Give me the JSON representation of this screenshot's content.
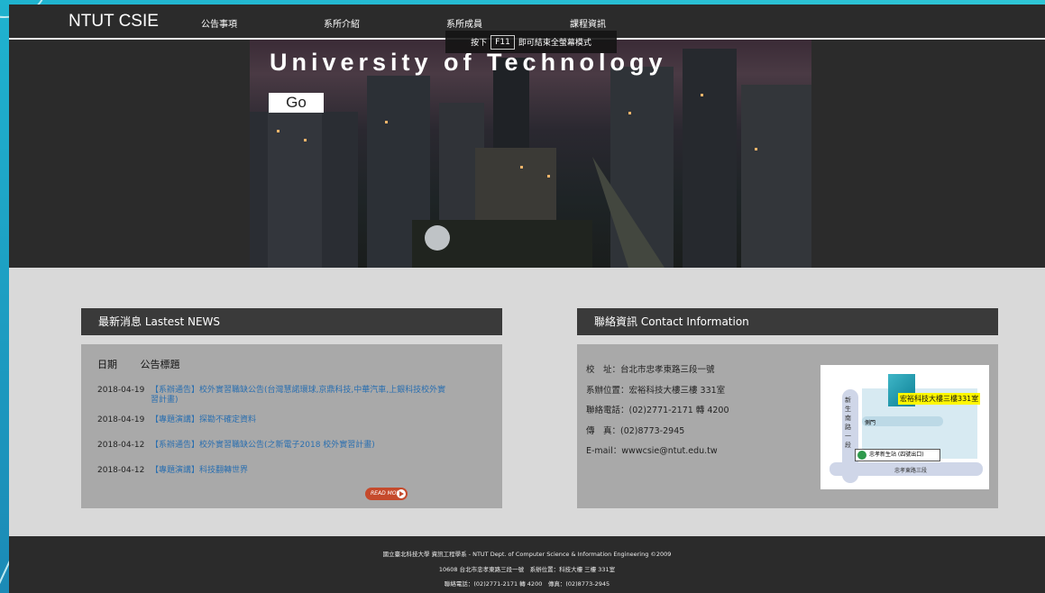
{
  "header": {
    "brand": "NTUT CSIE",
    "nav": [
      "公告事項",
      "系所介紹",
      "系所成員",
      "課程資訊"
    ]
  },
  "fullscreen_tip": {
    "prefix": "按下",
    "key": "F11",
    "suffix": "即可結束全螢幕模式"
  },
  "hero": {
    "title": "University of Technology",
    "button": "Go"
  },
  "news": {
    "heading": "最新消息 Lastest NEWS",
    "col_date": "日期",
    "col_title": "公告標題",
    "items": [
      {
        "date": "2018-04-19",
        "title": "【系辦通告】校外實習職缺公告(台灣慧諾環球,京鼎科技,中華汽車,上銀科技校外實習計畫)"
      },
      {
        "date": "2018-04-19",
        "title": "【專題演講】探勘不確定資料"
      },
      {
        "date": "2018-04-12",
        "title": "【系辦通告】校外實習職缺公告(之新電子2018 校外實習計畫)"
      },
      {
        "date": "2018-04-12",
        "title": "【專題演講】科技翻轉世界"
      }
    ],
    "read_more": "READ MORE"
  },
  "contact": {
    "heading": "聯絡資訊 Contact Information",
    "lines": [
      "校　址：台北市忠孝東路三段一號",
      "系辦位置：宏裕科技大樓三樓 331室",
      "聯絡電話：(02)2771-2171 轉 4200",
      "傳　真：(02)8773-2945",
      "E-mail：wwwcsie@ntut.edu.tw"
    ],
    "map": {
      "vertical_road": "新生南路一段",
      "horizontal_road": "忠孝東路三段",
      "gate": "側門",
      "building": "宏裕科技大樓三樓331室",
      "station": "忠孝新生站 (四號出口)"
    }
  },
  "footer": {
    "lines": [
      "國立臺北科技大學 資訊工程學系 - NTUT Dept. of Computer Science & Information Engineering ©2009",
      "10608 台北市忠孝東路三段一號　系辦位置：科技大樓 三樓 331室",
      "聯絡電話：(02)2771-2171 轉 4200　傳真：(02)8773-2945"
    ]
  },
  "colors": {
    "nav_bg": "#2b2b2b",
    "content_bg": "#d9d9d9",
    "panel_head": "#3a3a3a",
    "panel_body": "#a9a9a9",
    "link": "#2a6fb0",
    "read_more": "#c54a2c",
    "frame": "#1fb3cf"
  }
}
